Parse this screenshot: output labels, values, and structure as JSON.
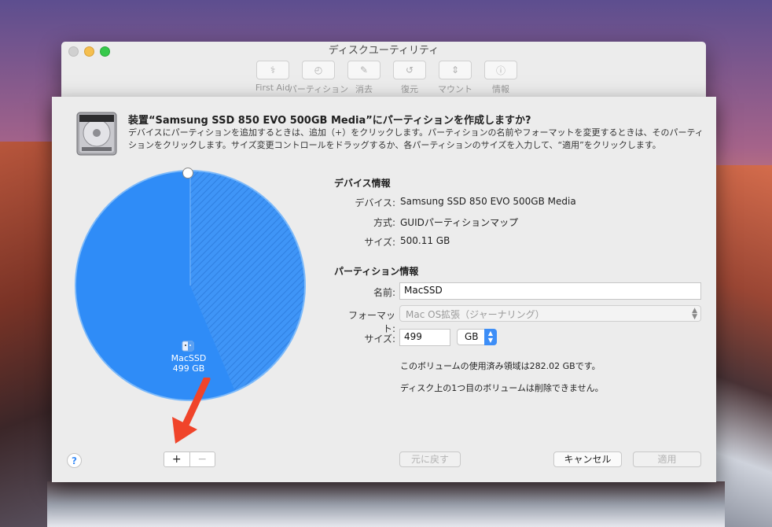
{
  "window": {
    "title": "ディスクユーティリティ",
    "toolbar": [
      {
        "label": "First Aid",
        "icon": "stethoscope-icon",
        "glyph": "⚕"
      },
      {
        "label": "パーティション",
        "icon": "partition-icon",
        "glyph": "◴"
      },
      {
        "label": "消去",
        "icon": "erase-icon",
        "glyph": "✎"
      },
      {
        "label": "復元",
        "icon": "restore-icon",
        "glyph": "↺"
      },
      {
        "label": "マウント",
        "icon": "mount-icon",
        "glyph": "⇕"
      },
      {
        "label": "情報",
        "icon": "info-icon",
        "glyph": "ⓘ"
      }
    ]
  },
  "sheet": {
    "heading": "装置“Samsung SSD 850 EVO 500GB Media”にパーティションを作成しますか?",
    "description": "デバイスにパーティションを追加するときは、追加（+）をクリックします。パーティションの名前やフォーマットを変更するときは、そのパーティションをクリックします。サイズ変更コントロールをドラッグするか、各パーティションのサイズを入力して、“適用”をクリックします。",
    "pie": {
      "partition_name": "MacSSD",
      "partition_size": "499 GB",
      "used_fraction": 0.564,
      "accent": "#3d8ef7"
    },
    "device_info": {
      "title": "デバイス情報",
      "device_label": "デバイス:",
      "device_value": "Samsung SSD 850 EVO 500GB Media",
      "scheme_label": "方式:",
      "scheme_value": "GUIDパーティションマップ",
      "size_label": "サイズ:",
      "size_value": "500.11 GB"
    },
    "partition_info": {
      "title": "パーティション情報",
      "name_label": "名前:",
      "name_value": "MacSSD",
      "format_label": "フォーマット:",
      "format_value": "Mac OS拡張（ジャーナリング）",
      "size_label": "サイズ:",
      "size_value": "499",
      "unit_value": "GB",
      "note_used": "このボリュームの使用済み領域は282.02 GBです。",
      "note_delete": "ディスク上の1つ目のボリュームは削除できません。"
    },
    "buttons": {
      "help": "?",
      "add": "+",
      "remove": "−",
      "revert": "元に戻す",
      "cancel": "キャンセル",
      "apply": "適用"
    }
  }
}
